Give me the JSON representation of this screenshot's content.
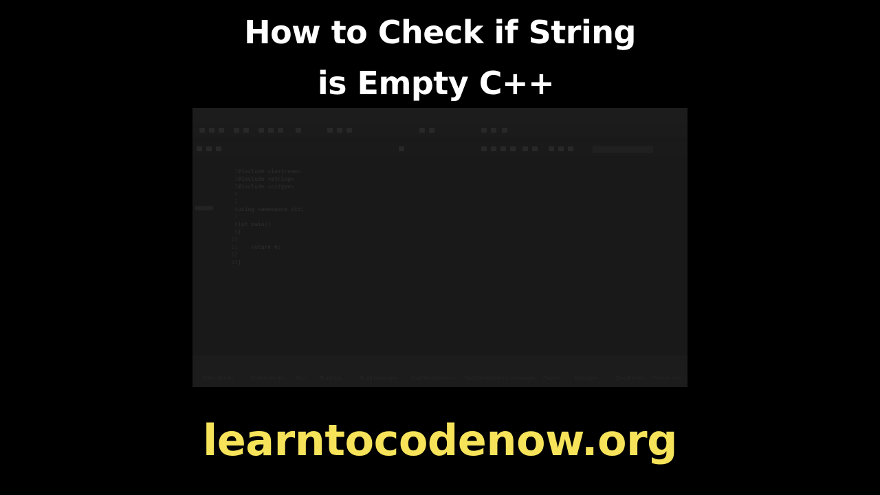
{
  "title": {
    "line1": "How to Check if String",
    "line2": "is Empty C++"
  },
  "editor": {
    "line_numbers": [
      "1",
      "2",
      "3",
      "4",
      "5",
      "6",
      "7",
      "8",
      "9",
      "10",
      "11",
      "12",
      "13"
    ],
    "code_lines": [
      "#include <iostream>",
      "#include <string>",
      "#include <cctype>",
      "",
      "using namespace std;",
      "",
      "int main()",
      "{",
      "",
      "    return 0;",
      "}"
    ]
  },
  "bottom_tabs": [
    "Code::Blocks",
    "Search results",
    "Cccc",
    "Build log",
    "Build messages",
    "CppCheck/Vera++",
    "CppCheck/Vera++ messages",
    "Cscope",
    "Debugger",
    "DoxyBlocks",
    "Fortran info"
  ],
  "footer": {
    "url": "learntocodenow.org"
  },
  "colors": {
    "background": "#000000",
    "title": "#ffffff",
    "url": "#f6e35a"
  }
}
